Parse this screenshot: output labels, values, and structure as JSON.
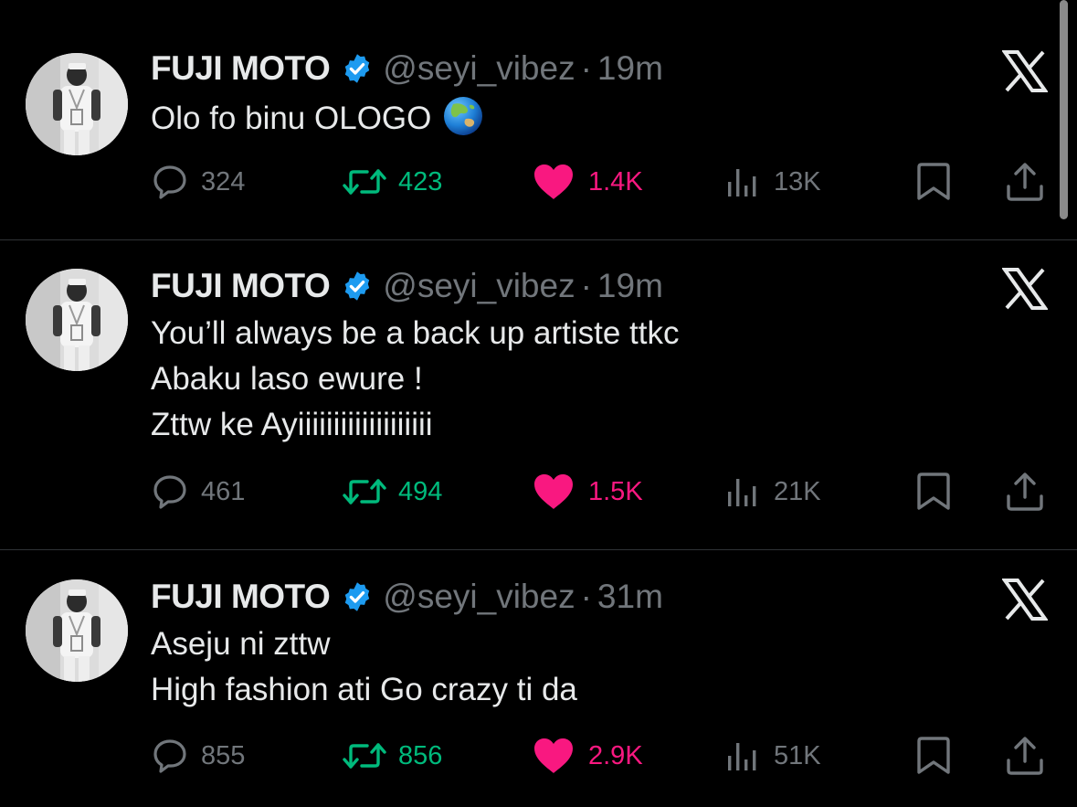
{
  "theme": {
    "background": "#000000",
    "text": "#e7e9ea",
    "muted": "#71767b",
    "divider": "#2f3336",
    "verified_blue": "#1d9bf0",
    "retweet_green": "#00ba7c",
    "like_pink": "#f91880"
  },
  "tweets": [
    {
      "author": {
        "name": "FUJI MOTO",
        "handle": "@seyi_vibez",
        "verified": true,
        "avatar_icon": "avatar-photo"
      },
      "separator": "·",
      "time": "19m",
      "lines": [
        "Olo fo binu OLOGO"
      ],
      "emoji": "globe-asia-australia",
      "stats": {
        "replies": "324",
        "retweets": "423",
        "likes": "1.4K",
        "views": "13K"
      },
      "liked": true
    },
    {
      "author": {
        "name": "FUJI MOTO",
        "handle": "@seyi_vibez",
        "verified": true,
        "avatar_icon": "avatar-photo"
      },
      "separator": "·",
      "time": "19m",
      "lines": [
        "You’ll always be a back up artiste ttkc",
        "Abaku laso ewure !",
        "Zttw ke  Ayiiiiiiiiiiiiiiiiiii"
      ],
      "stats": {
        "replies": "461",
        "retweets": "494",
        "likes": "1.5K",
        "views": "21K"
      },
      "liked": true
    },
    {
      "author": {
        "name": "FUJI MOTO",
        "handle": "@seyi_vibez",
        "verified": true,
        "avatar_icon": "avatar-photo"
      },
      "separator": "·",
      "time": "31m",
      "lines": [
        "Aseju ni zttw",
        "High fashion ati Go crazy ti da"
      ],
      "stats": {
        "replies": "855",
        "retweets": "856",
        "likes": "2.9K",
        "views": "51K"
      },
      "liked": true
    }
  ],
  "icons": {
    "reply": "reply-icon",
    "retweet": "retweet-icon",
    "like": "heart-icon",
    "views": "views-icon",
    "bookmark": "bookmark-icon",
    "share": "share-icon",
    "source": "x-logo-icon",
    "verified": "verified-badge-icon"
  }
}
